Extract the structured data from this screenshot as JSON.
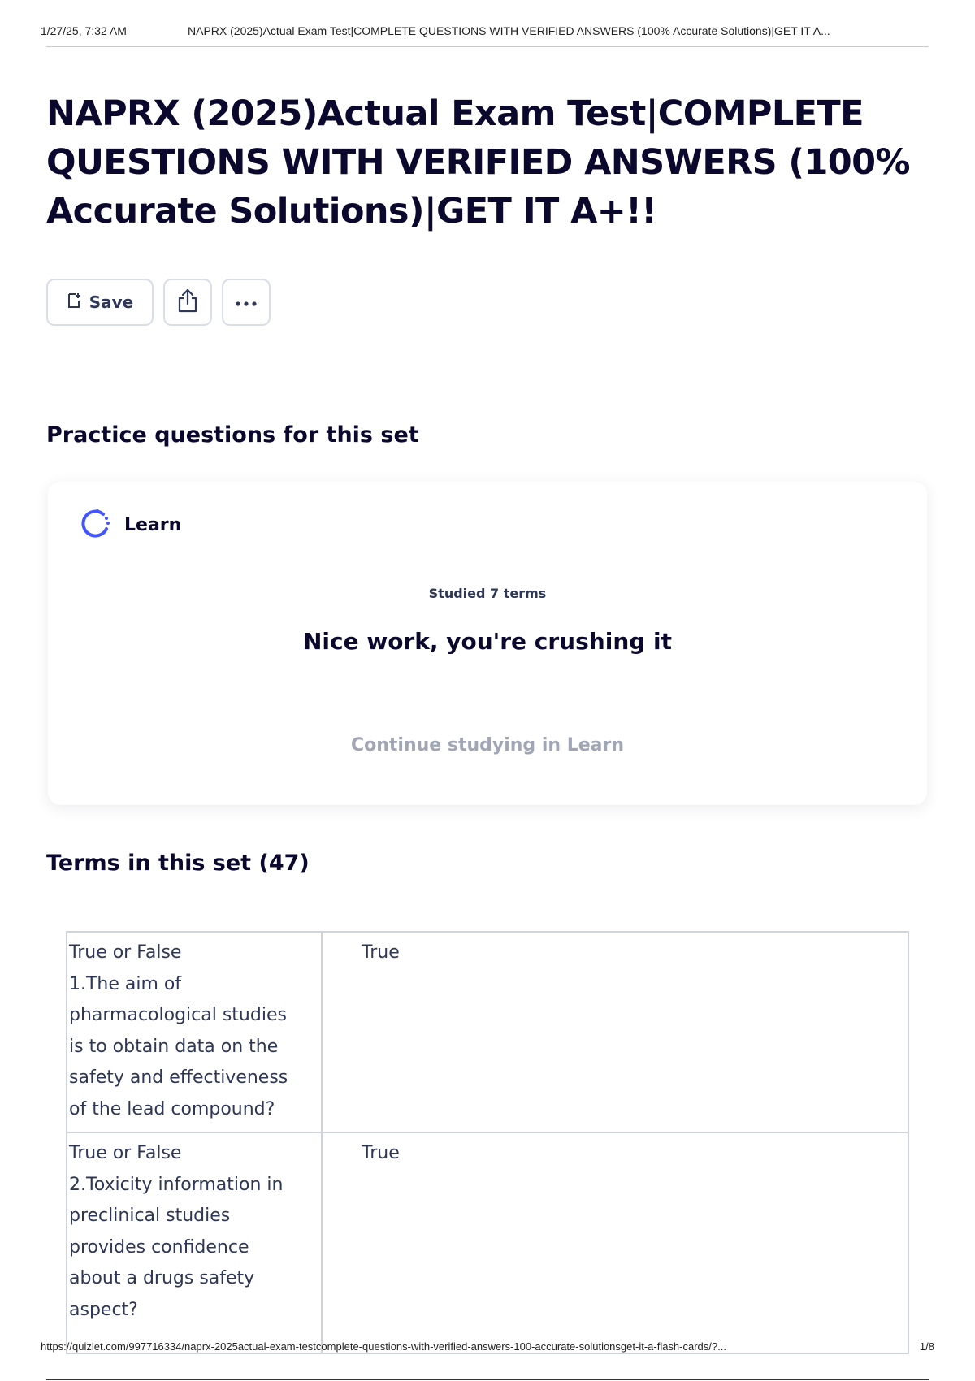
{
  "print_header": {
    "datetime": "1/27/25, 7:32 AM",
    "title": "NAPRX (2025)Actual Exam Test|COMPLETE QUESTIONS WITH VERIFIED ANSWERS (100% Accurate Solutions)|GET IT A..."
  },
  "page": {
    "title": "NAPRX (2025)Actual Exam Test|COMPLETE QUESTIONS WITH VERIFIED ANSWERS (100% Accurate Solutions)|GET IT A+!!"
  },
  "actions": {
    "save_label": "Save",
    "share_icon": "share-icon",
    "more_icon": "more-dots-icon"
  },
  "practice": {
    "heading": "Practice questions for this set",
    "learn": {
      "label": "Learn",
      "studied": "Studied 7 terms",
      "message": "Nice work, you're crushing it",
      "continue_label": "Continue studying in Learn"
    }
  },
  "terms": {
    "heading": "Terms in this set (47)",
    "rows": [
      {
        "term_lines": [
          "True or False",
          "1.The aim of",
          "pharmacological studies",
          "is to obtain data on the",
          "safety and effectiveness",
          "of the lead compound?"
        ],
        "definition": "True"
      },
      {
        "term_lines": [
          "True or False",
          "2.Toxicity information in",
          "preclinical studies",
          "provides confidence",
          "about a drugs safety",
          "aspect?"
        ],
        "definition": "True"
      }
    ]
  },
  "print_footer": {
    "url": "https://quizlet.com/997716334/naprx-2025actual-exam-testcomplete-questions-with-verified-answers-100-accurate-solutionsget-it-a-flash-cards/?...",
    "page_number": "1/8"
  },
  "colors": {
    "text_primary": "#0a092d",
    "text_secondary": "#2e3856",
    "muted": "#a0a6b5",
    "border": "#d9dde8",
    "learn_accent": "#4255ff"
  }
}
